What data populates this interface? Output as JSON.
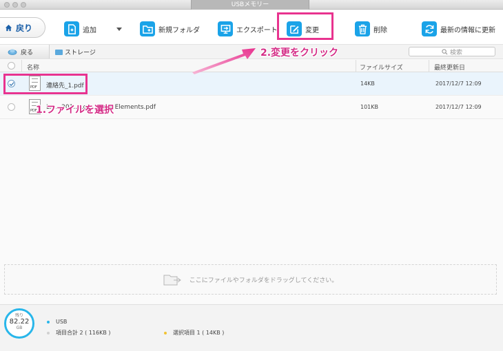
{
  "window": {
    "title": "USBメモリー"
  },
  "toolbar": {
    "back": "戻り",
    "add": "追加",
    "new_folder": "新規フォルダ",
    "export": "エクスポート",
    "modify": "変更",
    "delete": "削除",
    "refresh": "最新の情報に更新"
  },
  "pathbar": {
    "back": "戻る",
    "crumb": "ストレージ",
    "search_placeholder": "検索"
  },
  "table": {
    "headers": {
      "name": "名称",
      "size": "ファイルサイズ",
      "modified": "最終更新日"
    },
    "rows": [
      {
        "name": "連絡先_1.pdf",
        "size": "14KB",
        "modified": "2017/12/7  12:09",
        "checked": true
      },
      {
        "name": "L......201.....gin of the Elements.pdf",
        "size": "101KB",
        "modified": "2017/12/7  12:09",
        "checked": false
      }
    ]
  },
  "dropzone": {
    "text": "ここにファイルやフォルダをドラッグしてください。"
  },
  "footer": {
    "gauge_label": "残り",
    "gauge_value": "82.22",
    "gauge_unit": "GB",
    "device": "USB",
    "total": "項目合計 2 ( 116KB )",
    "selected": "選択項目 1 ( 14KB )"
  },
  "annotations": {
    "step1": "1.ファイルを選択",
    "step2": "2.変更をクリック"
  },
  "colors": {
    "accent": "#1aa3e8",
    "highlight": "#e8338f",
    "device_dot": "#28b6ea",
    "selected_dot": "#f1c232"
  }
}
